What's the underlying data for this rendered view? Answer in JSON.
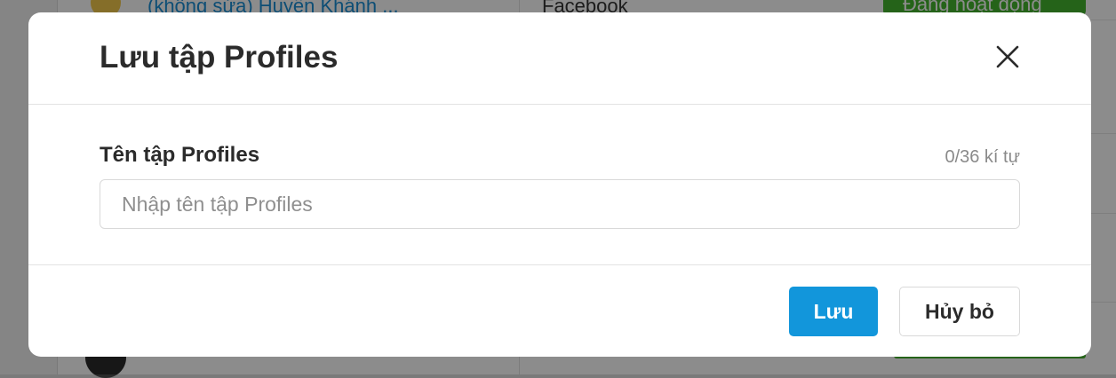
{
  "background": {
    "row_name": "(không sửa) Huyền Khánh ...",
    "row_platform": "Facebook",
    "row_status": "Đang hoạt động"
  },
  "modal": {
    "title": "Lưu tập Profiles",
    "close_icon": "close-icon",
    "field_label": "Tên tập Profiles",
    "char_count": "0/36 kí tự",
    "input_value": "",
    "input_placeholder": "Nhập tên tập Profiles",
    "save_label": "Lưu",
    "cancel_label": "Hủy bỏ"
  },
  "colors": {
    "primary": "#1296db",
    "status_green": "#44b52f",
    "link_blue": "#1a8fd6"
  }
}
